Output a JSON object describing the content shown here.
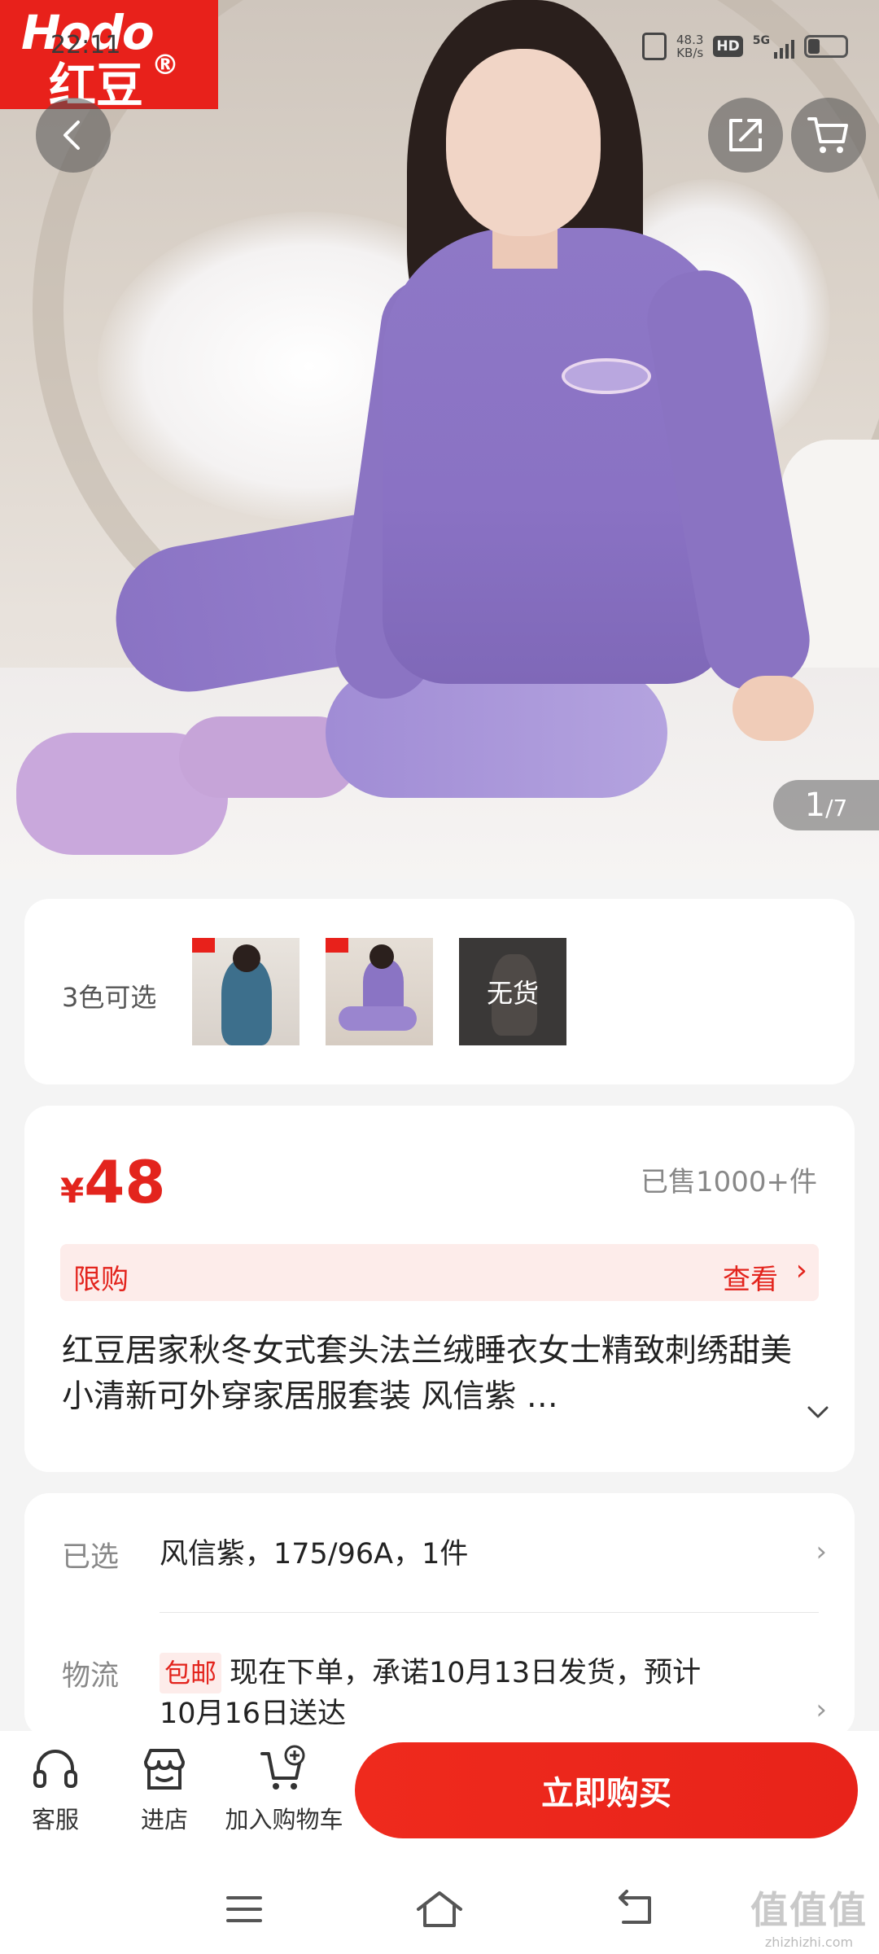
{
  "brand": {
    "en": "Hodo",
    "cn": "红豆",
    "reg": "®"
  },
  "status_bar": {
    "time": "22:11",
    "net_speed_value": "48.3",
    "net_speed_unit": "KB/s",
    "hd": "HD",
    "network": "5G"
  },
  "gallery": {
    "current": "1",
    "total": "/7"
  },
  "colors": {
    "label": "3色可选",
    "swatches": [
      {
        "name": "blue",
        "oos": ""
      },
      {
        "name": "purple",
        "oos": ""
      },
      {
        "name": "other",
        "oos": "无货"
      }
    ]
  },
  "price": {
    "currency": "¥",
    "value": "48",
    "sold": "已售1000+件",
    "limit_label": "限购",
    "limit_action": "查看"
  },
  "title": "红豆居家秋冬女式套头法兰绒睡衣女士精致刺绣甜美小清新可外穿家居服套装 风信紫 …",
  "spec": {
    "selected_label": "已选",
    "selected_value": "风信紫，175/96A，1件",
    "shipping_label": "物流",
    "shipping_badge": "包邮",
    "shipping_line1": "现在下单，承诺10月13日发货，预计",
    "shipping_line2": "10月16日送达"
  },
  "bottom_bar": {
    "service": "客服",
    "store": "进店",
    "add_cart": "加入购物车",
    "buy_now": "立即购买"
  },
  "watermark": {
    "big": "值值值",
    "small": "zhizhizhi.com"
  },
  "colors_theme": {
    "accent": "#e3241d",
    "buy_button": "#ef2a1d"
  }
}
